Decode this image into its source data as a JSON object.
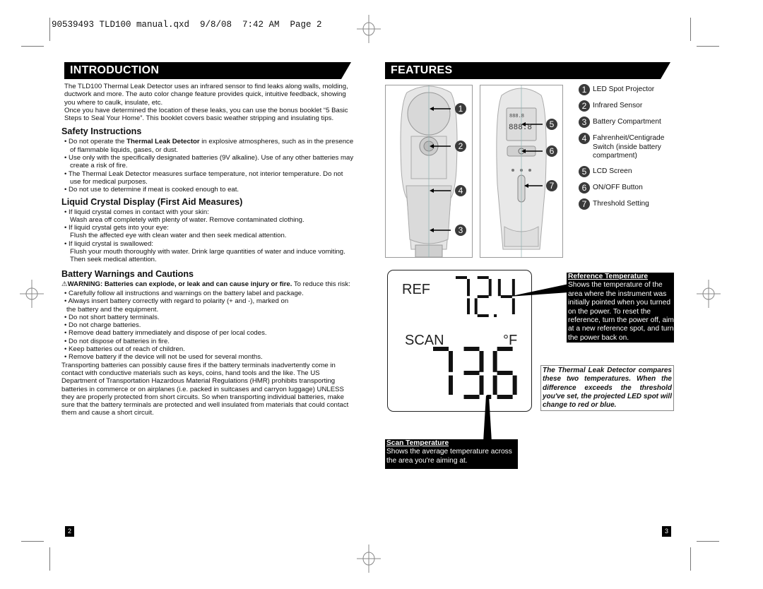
{
  "slug": "90539493 TLD100 manual.qxd  9/8/08  7:42 AM  Page 2",
  "introduction": {
    "title": "INTRODUCTION",
    "paragraphs": [
      "The TLD100 Thermal Leak Detector uses an infrared sensor to find leaks along walls, molding, ductwork and more. The auto color change feature provides quick, intuitive feedback, showing you where to caulk, insulate, etc.",
      "Once you have determined the location of these leaks, you can use the bonus booklet “5 Basic Steps to Seal Your Home”. This booklet covers basic weather stripping and insulating tips."
    ],
    "safety": {
      "heading": "Safety Instructions",
      "b1_pre": "Do not operate the ",
      "b1_bold": "Thermal Leak Detector",
      "b1_post": " in explosive atmospheres, such as in the presence of flammable liquids, gases, or dust.",
      "b2": "Use only with the specifically designated batteries (9V alkaline). Use of any other batteries may create a risk of fire.",
      "b3": "The Thermal Leak Detector measures surface temperature, not interior temperature.  Do not use for medical purposes.",
      "b4": "Do not use to determine if meat is cooked enough to eat."
    },
    "lcd_first_aid": {
      "heading": "Liquid Crystal Display (First Aid Measures)",
      "items": [
        {
          "bullet": "If liquid crystal comes in contact with your skin:",
          "text": "Wash area off completely with plenty of water. Remove contaminated clothing."
        },
        {
          "bullet": "If liquid crystal gets into your eye:",
          "text": "Flush the affected eye with clean water and then seek medical attention."
        },
        {
          "bullet": "If liquid crystal is swallowed:",
          "text": "Flush your mouth thoroughly with water. Drink large quantities of water and induce vomiting. Then seek medical attention."
        }
      ]
    },
    "battery": {
      "heading": "Battery Warnings and Cautions",
      "warning_icon": "warning-triangle-icon",
      "warning_bold": "WARNING: Batteries can explode, or leak and can cause injury or fire.",
      "warning_rest": " To reduce this risk:",
      "b1": "Carefully follow all instructions and warnings on the battery label and package.",
      "b2": "Always insert battery correctly with regard to polarity (+ and -), marked on",
      "b2_cont": "the battery and the equipment.",
      "b3": "Do not short battery terminals.",
      "b4": "Do not charge batteries.",
      "b5": "Remove dead battery immediately and dispose of per local codes.",
      "b6": "Do not dispose of batteries in fire.",
      "b7": "Keep batteries out of reach of children.",
      "b8": "Remove battery if the device will not be used for several months.",
      "transport": "Transporting batteries can possibly cause fires if the battery terminals inadvertently come in contact with conductive materials such as keys, coins, hand tools and the like. The US Department of Transportation Hazardous Material Regulations (HMR) prohibits transporting batteries in commerce or on airplanes (i.e. packed in suitcases and carryon luggage) UNLESS they are properly protected from short circuits. So when transporting individual batteries, make sure that the battery terminals are protected and well insulated from materials that could contact them and cause a short circuit."
    }
  },
  "features": {
    "title": "FEATURES",
    "legend": [
      {
        "n": "1",
        "label": "LED Spot Projector"
      },
      {
        "n": "2",
        "label": "Infrared Sensor"
      },
      {
        "n": "3",
        "label": "Battery Compartment"
      },
      {
        "n": "4",
        "label": "Fahrenheit/Centigrade Switch (inside battery compartment)"
      },
      {
        "n": "5",
        "label": "LCD Screen"
      },
      {
        "n": "6",
        "label": "ON/OFF Button"
      },
      {
        "n": "7",
        "label": "Threshold Setting"
      }
    ],
    "device_lcd_digits": "888.8",
    "lcd": {
      "ref_label": "REF",
      "ref_value": "72.4",
      "scan_label": "SCAN",
      "unit": "°F",
      "scan_value": "73.6"
    },
    "ref_callout": {
      "title": "Reference Temperature",
      "text": "Shows the temperature of the area where the instrument was initially pointed when you turned on the power.  To reset the reference, turn the power off, aim at a new reference spot, and turn the power back on."
    },
    "scan_callout": {
      "title": "Scan Temperature",
      "text": "Shows the average temperature across the area you're aiming at."
    },
    "compare_note": "The Thermal Leak Detector compares these two temperatures.  When the difference exceeds the threshold you've set, the projected LED spot will change to red or blue."
  },
  "page_numbers": {
    "left": "2",
    "right": "3"
  }
}
